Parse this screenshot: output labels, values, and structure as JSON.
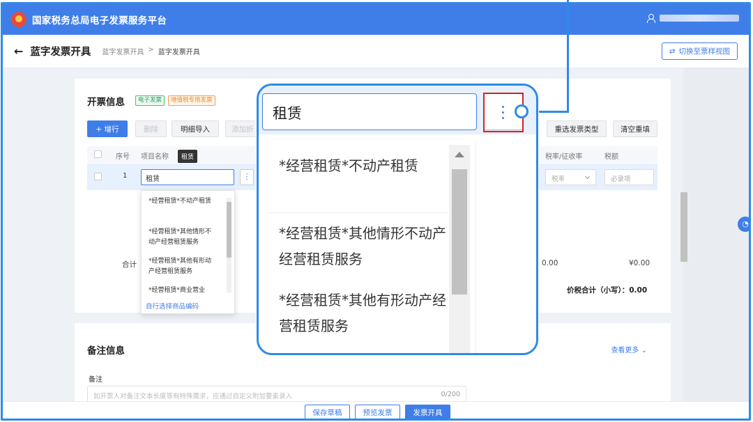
{
  "app": {
    "title": "国家税务总局电子发票服务平台"
  },
  "header": {
    "back_icon": "←",
    "page_title": "蓝字发票开具",
    "breadcrumb": [
      "蓝字发票开具",
      ">",
      "蓝字发票开具"
    ],
    "switch_button": "切换至票样视图"
  },
  "invoice_info": {
    "heading": "开票信息",
    "tags": [
      "电子发票",
      "增值税专用发票"
    ],
    "toolbar": {
      "add_row": "+ 增行",
      "delete": "删除",
      "import_detail": "明细导入",
      "add_discount": "添加折",
      "reselect_type": "重选发票类型",
      "clear_refill": "清空重填"
    },
    "columns": {
      "seq": "序号",
      "item_name": "项目名称",
      "tax_rate": "税率/征收率",
      "tax_amount": "税额"
    },
    "row": {
      "seq": "1",
      "item_name_value": "租赁",
      "tooltip": "租赁",
      "dots": "⋮",
      "tax_rate_placeholder": "税率",
      "tax_amount_placeholder": "必录项"
    },
    "dropdown": {
      "items": [
        "*经营租赁*不动产租赁",
        "*经营租赁*其他情形不动产经营租赁服务",
        "*经营租赁*其他有形动产经营租赁服务",
        "*经营租赁*商业营业"
      ],
      "footer": "自行选择商品编码"
    },
    "summary": {
      "total_label": "合计",
      "amount": "0.00",
      "tax": "¥0.00",
      "grand_total": "价税合计（小写）：0.00"
    }
  },
  "remarks": {
    "heading": "备注信息",
    "see_more": "查看更多 ⌄",
    "label": "备注",
    "placeholder": "如开票人对备注文本长度等有特殊需求，应通过自定义附加要素录入",
    "count": "0/200"
  },
  "footer": {
    "save_draft": "保存草稿",
    "preview": "预览发票",
    "issue": "发票开具"
  },
  "zoom_callout": {
    "input_value": "租赁",
    "items": [
      "*经营租赁*不动产租赁",
      "*经营租赁*其他情形不动产经营租赁服务",
      "*经营租赁*其他有形动产经营租赁服务"
    ]
  },
  "help_icon": "◔",
  "colors": {
    "brand": "#3f7ee8",
    "callout": "#2e8ae6",
    "highlight": "#e11d1d"
  }
}
